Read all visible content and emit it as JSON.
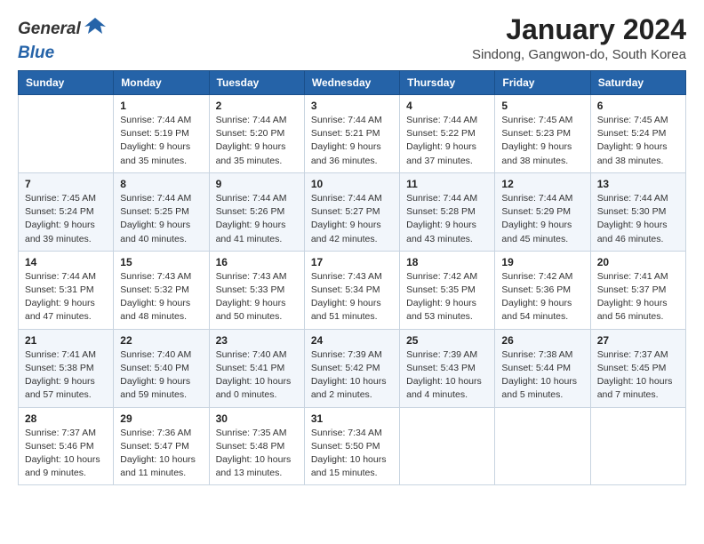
{
  "header": {
    "logo_general": "General",
    "logo_blue": "Blue",
    "title": "January 2024",
    "subtitle": "Sindong, Gangwon-do, South Korea"
  },
  "weekdays": [
    "Sunday",
    "Monday",
    "Tuesday",
    "Wednesday",
    "Thursday",
    "Friday",
    "Saturday"
  ],
  "weeks": [
    [
      {
        "day": "",
        "sunrise": "",
        "sunset": "",
        "daylight": ""
      },
      {
        "day": "1",
        "sunrise": "Sunrise: 7:44 AM",
        "sunset": "Sunset: 5:19 PM",
        "daylight": "Daylight: 9 hours and 35 minutes."
      },
      {
        "day": "2",
        "sunrise": "Sunrise: 7:44 AM",
        "sunset": "Sunset: 5:20 PM",
        "daylight": "Daylight: 9 hours and 35 minutes."
      },
      {
        "day": "3",
        "sunrise": "Sunrise: 7:44 AM",
        "sunset": "Sunset: 5:21 PM",
        "daylight": "Daylight: 9 hours and 36 minutes."
      },
      {
        "day": "4",
        "sunrise": "Sunrise: 7:44 AM",
        "sunset": "Sunset: 5:22 PM",
        "daylight": "Daylight: 9 hours and 37 minutes."
      },
      {
        "day": "5",
        "sunrise": "Sunrise: 7:45 AM",
        "sunset": "Sunset: 5:23 PM",
        "daylight": "Daylight: 9 hours and 38 minutes."
      },
      {
        "day": "6",
        "sunrise": "Sunrise: 7:45 AM",
        "sunset": "Sunset: 5:24 PM",
        "daylight": "Daylight: 9 hours and 38 minutes."
      }
    ],
    [
      {
        "day": "7",
        "sunrise": "Sunrise: 7:45 AM",
        "sunset": "Sunset: 5:24 PM",
        "daylight": "Daylight: 9 hours and 39 minutes."
      },
      {
        "day": "8",
        "sunrise": "Sunrise: 7:44 AM",
        "sunset": "Sunset: 5:25 PM",
        "daylight": "Daylight: 9 hours and 40 minutes."
      },
      {
        "day": "9",
        "sunrise": "Sunrise: 7:44 AM",
        "sunset": "Sunset: 5:26 PM",
        "daylight": "Daylight: 9 hours and 41 minutes."
      },
      {
        "day": "10",
        "sunrise": "Sunrise: 7:44 AM",
        "sunset": "Sunset: 5:27 PM",
        "daylight": "Daylight: 9 hours and 42 minutes."
      },
      {
        "day": "11",
        "sunrise": "Sunrise: 7:44 AM",
        "sunset": "Sunset: 5:28 PM",
        "daylight": "Daylight: 9 hours and 43 minutes."
      },
      {
        "day": "12",
        "sunrise": "Sunrise: 7:44 AM",
        "sunset": "Sunset: 5:29 PM",
        "daylight": "Daylight: 9 hours and 45 minutes."
      },
      {
        "day": "13",
        "sunrise": "Sunrise: 7:44 AM",
        "sunset": "Sunset: 5:30 PM",
        "daylight": "Daylight: 9 hours and 46 minutes."
      }
    ],
    [
      {
        "day": "14",
        "sunrise": "Sunrise: 7:44 AM",
        "sunset": "Sunset: 5:31 PM",
        "daylight": "Daylight: 9 hours and 47 minutes."
      },
      {
        "day": "15",
        "sunrise": "Sunrise: 7:43 AM",
        "sunset": "Sunset: 5:32 PM",
        "daylight": "Daylight: 9 hours and 48 minutes."
      },
      {
        "day": "16",
        "sunrise": "Sunrise: 7:43 AM",
        "sunset": "Sunset: 5:33 PM",
        "daylight": "Daylight: 9 hours and 50 minutes."
      },
      {
        "day": "17",
        "sunrise": "Sunrise: 7:43 AM",
        "sunset": "Sunset: 5:34 PM",
        "daylight": "Daylight: 9 hours and 51 minutes."
      },
      {
        "day": "18",
        "sunrise": "Sunrise: 7:42 AM",
        "sunset": "Sunset: 5:35 PM",
        "daylight": "Daylight: 9 hours and 53 minutes."
      },
      {
        "day": "19",
        "sunrise": "Sunrise: 7:42 AM",
        "sunset": "Sunset: 5:36 PM",
        "daylight": "Daylight: 9 hours and 54 minutes."
      },
      {
        "day": "20",
        "sunrise": "Sunrise: 7:41 AM",
        "sunset": "Sunset: 5:37 PM",
        "daylight": "Daylight: 9 hours and 56 minutes."
      }
    ],
    [
      {
        "day": "21",
        "sunrise": "Sunrise: 7:41 AM",
        "sunset": "Sunset: 5:38 PM",
        "daylight": "Daylight: 9 hours and 57 minutes."
      },
      {
        "day": "22",
        "sunrise": "Sunrise: 7:40 AM",
        "sunset": "Sunset: 5:40 PM",
        "daylight": "Daylight: 9 hours and 59 minutes."
      },
      {
        "day": "23",
        "sunrise": "Sunrise: 7:40 AM",
        "sunset": "Sunset: 5:41 PM",
        "daylight": "Daylight: 10 hours and 0 minutes."
      },
      {
        "day": "24",
        "sunrise": "Sunrise: 7:39 AM",
        "sunset": "Sunset: 5:42 PM",
        "daylight": "Daylight: 10 hours and 2 minutes."
      },
      {
        "day": "25",
        "sunrise": "Sunrise: 7:39 AM",
        "sunset": "Sunset: 5:43 PM",
        "daylight": "Daylight: 10 hours and 4 minutes."
      },
      {
        "day": "26",
        "sunrise": "Sunrise: 7:38 AM",
        "sunset": "Sunset: 5:44 PM",
        "daylight": "Daylight: 10 hours and 5 minutes."
      },
      {
        "day": "27",
        "sunrise": "Sunrise: 7:37 AM",
        "sunset": "Sunset: 5:45 PM",
        "daylight": "Daylight: 10 hours and 7 minutes."
      }
    ],
    [
      {
        "day": "28",
        "sunrise": "Sunrise: 7:37 AM",
        "sunset": "Sunset: 5:46 PM",
        "daylight": "Daylight: 10 hours and 9 minutes."
      },
      {
        "day": "29",
        "sunrise": "Sunrise: 7:36 AM",
        "sunset": "Sunset: 5:47 PM",
        "daylight": "Daylight: 10 hours and 11 minutes."
      },
      {
        "day": "30",
        "sunrise": "Sunrise: 7:35 AM",
        "sunset": "Sunset: 5:48 PM",
        "daylight": "Daylight: 10 hours and 13 minutes."
      },
      {
        "day": "31",
        "sunrise": "Sunrise: 7:34 AM",
        "sunset": "Sunset: 5:50 PM",
        "daylight": "Daylight: 10 hours and 15 minutes."
      },
      {
        "day": "",
        "sunrise": "",
        "sunset": "",
        "daylight": ""
      },
      {
        "day": "",
        "sunrise": "",
        "sunset": "",
        "daylight": ""
      },
      {
        "day": "",
        "sunrise": "",
        "sunset": "",
        "daylight": ""
      }
    ]
  ]
}
